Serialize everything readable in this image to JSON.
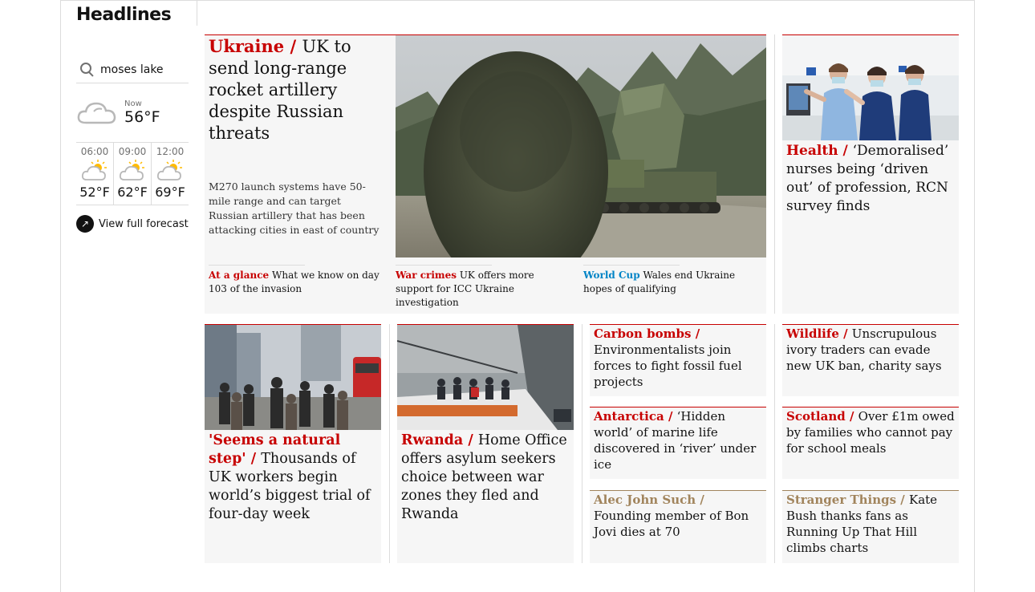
{
  "section": {
    "title": "Headlines"
  },
  "weather": {
    "search_value": "moses lake",
    "now_label": "Now",
    "now_temp": "56°F",
    "forecast": [
      {
        "time": "06:00",
        "temp": "52°F",
        "icon": "partly-sunny-icon"
      },
      {
        "time": "09:00",
        "temp": "62°F",
        "icon": "partly-sunny-icon"
      },
      {
        "time": "12:00",
        "temp": "69°F",
        "icon": "partly-sunny-icon"
      }
    ],
    "full_forecast_label": "View full forecast"
  },
  "main_story": {
    "kicker": "Ukraine",
    "slash": " / ",
    "headline": "UK to send long-range rocket artillery despite Russian threats",
    "trail": "M270 launch systems have 50-mile range and can target Russian artillery that has been attacking cities in east of country",
    "image": "rocket-launcher-photo",
    "sublinks": [
      {
        "kicker": "At a glance",
        "text": "What we know on day 103 of the invasion",
        "kicker_color": "#c70000"
      },
      {
        "kicker": "War crimes",
        "text": "UK offers more support for ICC Ukraine investigation",
        "kicker_color": "#c70000"
      },
      {
        "kicker": "World Cup",
        "text": "Wales end Ukraine hopes of qualifying",
        "kicker_color": "#0084c6"
      }
    ]
  },
  "health_story": {
    "kicker": "Health",
    "slash": " / ",
    "headline": "‘Demoralised’ nurses being ‘driven out’ of profession, RCN survey finds",
    "image": "nurses-photo"
  },
  "image_stories": [
    {
      "kicker": "'Seems a natural step'",
      "slash": " / ",
      "headline": "Thousands of UK workers begin world’s biggest trial of four-day week",
      "image": "commuters-photo"
    },
    {
      "kicker": "Rwanda",
      "slash": " / ",
      "headline": "Home Office offers asylum seekers choice between war zones they fled and Rwanda",
      "image": "boat-photo"
    }
  ],
  "small_stories": [
    {
      "kicker": "Carbon bombs",
      "slash": " / ",
      "headline": "Environmentalists join forces to fight fossil fuel projects"
    },
    {
      "kicker": "Wildlife",
      "slash": " / ",
      "headline": "Unscrupulous ivory traders can evade new UK ban, charity says"
    },
    {
      "kicker": "Antarctica",
      "slash": " / ",
      "headline": "‘Hidden world’ of marine life discovered in ‘river’ under ice"
    },
    {
      "kicker": "Scotland",
      "slash": " / ",
      "headline": "Over £1m owed by families who cannot pay for school meals"
    },
    {
      "kicker": "Alec John Such",
      "slash": " / ",
      "headline": "Founding member of Bon Jovi dies at 70"
    },
    {
      "kicker": "Stranger Things",
      "slash": " / ",
      "headline": "Kate Bush thanks fans as Running Up That Hill climbs charts"
    }
  ],
  "colors": {
    "news_red": "#c70000",
    "culture_brown": "#a1845c",
    "sport_blue": "#0084c6",
    "card_bg": "#f6f6f6"
  }
}
